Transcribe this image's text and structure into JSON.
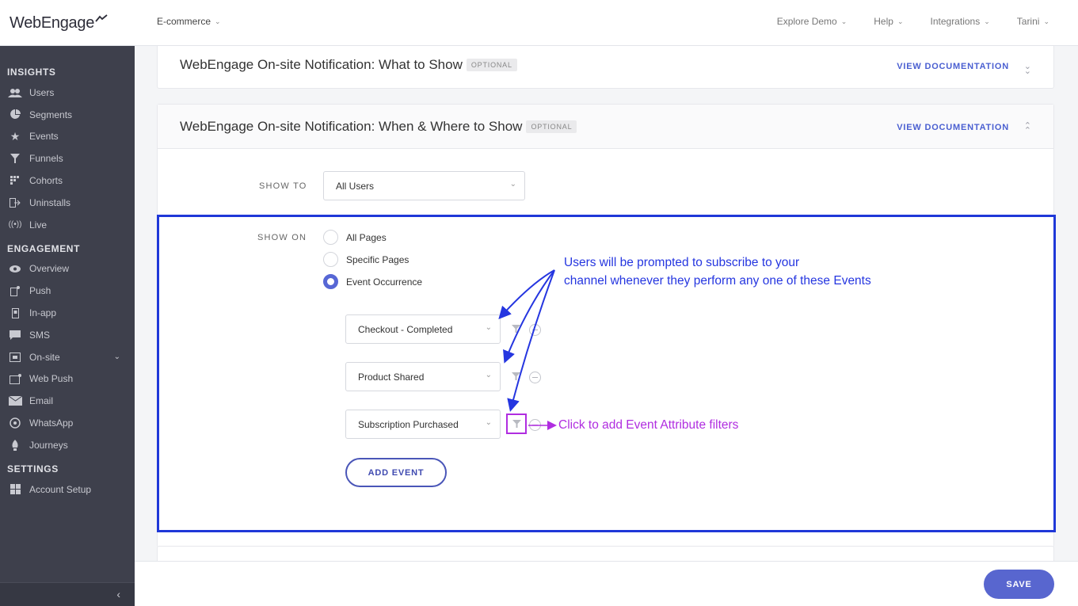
{
  "app": {
    "logo_text": "WebEngage"
  },
  "header": {
    "project": "E-commerce",
    "nav": [
      "Explore Demo",
      "Help",
      "Integrations",
      "Tarini"
    ]
  },
  "sidebar": {
    "insights_title": "INSIGHTS",
    "insights": [
      {
        "label": "Users",
        "icon": "users-icon"
      },
      {
        "label": "Segments",
        "icon": "pie-icon"
      },
      {
        "label": "Events",
        "icon": "star-icon"
      },
      {
        "label": "Funnels",
        "icon": "funnel-icon"
      },
      {
        "label": "Cohorts",
        "icon": "cohorts-icon"
      },
      {
        "label": "Uninstalls",
        "icon": "uninstall-icon"
      },
      {
        "label": "Live",
        "icon": "live-icon"
      }
    ],
    "engagement_title": "ENGAGEMENT",
    "engagement": [
      {
        "label": "Overview",
        "icon": "eye-icon"
      },
      {
        "label": "Push",
        "icon": "push-icon"
      },
      {
        "label": "In-app",
        "icon": "inapp-icon"
      },
      {
        "label": "SMS",
        "icon": "sms-icon"
      },
      {
        "label": "On-site",
        "icon": "onsite-icon"
      },
      {
        "label": "Web Push",
        "icon": "webpush-icon"
      },
      {
        "label": "Email",
        "icon": "email-icon"
      },
      {
        "label": "WhatsApp",
        "icon": "whatsapp-icon"
      },
      {
        "label": "Journeys",
        "icon": "rocket-icon"
      }
    ],
    "settings_title": "SETTINGS",
    "settings": [
      {
        "label": "Account Setup",
        "icon": "grid-icon"
      }
    ]
  },
  "cards": {
    "what": {
      "title": "WebEngage On-site Notification: What to Show",
      "badge": "OPTIONAL",
      "doc": "VIEW DOCUMENTATION"
    },
    "when": {
      "title": "WebEngage On-site Notification: When & Where to Show",
      "badge": "OPTIONAL",
      "doc": "VIEW DOCUMENTATION"
    }
  },
  "form": {
    "show_to_label": "SHOW TO",
    "show_to_value": "All Users",
    "show_on_label": "SHOW ON",
    "show_on_options": [
      "All Pages",
      "Specific Pages",
      "Event Occurrence"
    ],
    "show_on_selected": "Event Occurrence",
    "events": [
      "Checkout - Completed",
      "Product Shared",
      "Subscription Purchased"
    ],
    "add_event": "ADD EVENT"
  },
  "annotations": {
    "line1": "Users will be prompted to subscribe to your",
    "line2": "channel whenever they perform any one of these Events",
    "filter_note": "Click to add Event Attribute filters",
    "main_color": "#2536e0",
    "filter_color": "#b02de0"
  },
  "footer": {
    "save": "SAVE"
  }
}
